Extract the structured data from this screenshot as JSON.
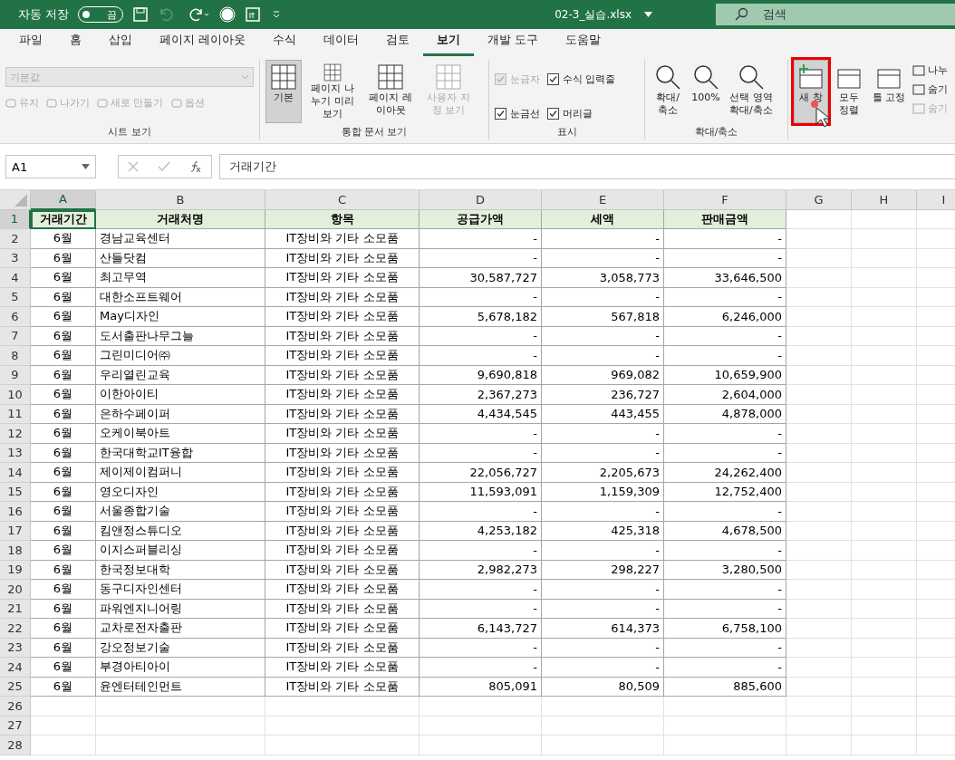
{
  "title_bar": {
    "autosave_label": "자동 저장",
    "autosave_toggle": {
      "on": false,
      "label": "끔"
    },
    "file_name": "02-3_실습.xlsx",
    "search": {
      "placeholder": "검색"
    }
  },
  "tabs": [
    {
      "label": "파일",
      "selected": false
    },
    {
      "label": "홈",
      "selected": false
    },
    {
      "label": "삽입",
      "selected": false
    },
    {
      "label": "페이지 레이아웃",
      "selected": false
    },
    {
      "label": "수식",
      "selected": false
    },
    {
      "label": "데이터",
      "selected": false
    },
    {
      "label": "검토",
      "selected": false
    },
    {
      "label": "보기",
      "selected": true
    },
    {
      "label": "개발 도구",
      "selected": false
    },
    {
      "label": "도움말",
      "selected": false
    }
  ],
  "ribbon": {
    "sheet_view": {
      "label": "시트 보기",
      "dropdown": "기본값",
      "items": [
        {
          "label": "유지",
          "disabled": true
        },
        {
          "label": "나가기",
          "disabled": true
        },
        {
          "label": "새로 만들기",
          "disabled": true
        },
        {
          "label": "옵션",
          "disabled": true
        }
      ]
    },
    "workbook_views": {
      "label": "통합 문서 보기",
      "buttons": [
        {
          "label": "기본",
          "selected": true,
          "disabled": false
        },
        {
          "label": "페이지 나누기 미리 보기",
          "selected": false,
          "disabled": false
        },
        {
          "label": "페이지 레이아웃",
          "selected": false,
          "disabled": false
        },
        {
          "label": "사용자 지정 보기",
          "selected": false,
          "disabled": true
        }
      ]
    },
    "show": {
      "label": "표시",
      "checkboxes": [
        {
          "label": "눈금자",
          "checked": true,
          "disabled": true
        },
        {
          "label": "수식 입력줄",
          "checked": true,
          "disabled": false
        },
        {
          "label": "눈금선",
          "checked": true,
          "disabled": false
        },
        {
          "label": "머리글",
          "checked": true,
          "disabled": false
        }
      ]
    },
    "zoom": {
      "label": "확대/축소",
      "buttons": [
        {
          "label": "확대/\n축소"
        },
        {
          "label": "100%"
        },
        {
          "label": "선택 영역\n확대/축소"
        }
      ]
    },
    "window": {
      "buttons": [
        {
          "label": "새 창",
          "highlighted": true
        },
        {
          "label": "모두\n정렬",
          "highlighted": false
        },
        {
          "label": "틀 고정",
          "highlighted": false
        }
      ],
      "small": [
        {
          "label": "나누",
          "disabled": false
        },
        {
          "label": "숨기",
          "disabled": false
        },
        {
          "label": "숨기",
          "disabled": true
        }
      ]
    }
  },
  "formula_bar": {
    "name_box": "A1",
    "formula": "거래기간"
  },
  "sheet": {
    "columns": [
      {
        "label": "A",
        "selected": true
      },
      {
        "label": "B",
        "selected": false
      },
      {
        "label": "C",
        "selected": false
      },
      {
        "label": "D",
        "selected": false
      },
      {
        "label": "E",
        "selected": false
      },
      {
        "label": "F",
        "selected": false
      },
      {
        "label": "G",
        "selected": false
      },
      {
        "label": "H",
        "selected": false
      },
      {
        "label": "I",
        "selected": false
      }
    ],
    "header": {
      "row": "1",
      "selected": true,
      "cells": [
        "거래기간",
        "거래처명",
        "항목",
        "공급가액",
        "세액",
        "판매금액"
      ]
    },
    "rows": [
      {
        "row": "2",
        "cells": [
          "6월",
          "경남교육센터",
          "IT장비와 기타 소모품",
          "-",
          "-",
          "-"
        ]
      },
      {
        "row": "3",
        "cells": [
          "6월",
          "산들닷컴",
          "IT장비와 기타 소모품",
          "-",
          "-",
          "-"
        ]
      },
      {
        "row": "4",
        "cells": [
          "6월",
          "최고무역",
          "IT장비와 기타 소모품",
          "30,587,727",
          "3,058,773",
          "33,646,500"
        ]
      },
      {
        "row": "5",
        "cells": [
          "6월",
          "대한소프트웨어",
          "IT장비와 기타 소모품",
          "-",
          "-",
          "-"
        ]
      },
      {
        "row": "6",
        "cells": [
          "6월",
          "May디자인",
          "IT장비와 기타 소모품",
          "5,678,182",
          "567,818",
          "6,246,000"
        ]
      },
      {
        "row": "7",
        "cells": [
          "6월",
          "도서출판나무그늘",
          "IT장비와 기타 소모품",
          "-",
          "-",
          "-"
        ]
      },
      {
        "row": "8",
        "cells": [
          "6월",
          "그린미디어㈜",
          "IT장비와 기타 소모품",
          "-",
          "-",
          "-"
        ]
      },
      {
        "row": "9",
        "cells": [
          "6월",
          "우리열린교육",
          "IT장비와 기타 소모품",
          "9,690,818",
          "969,082",
          "10,659,900"
        ]
      },
      {
        "row": "10",
        "cells": [
          "6월",
          "이한아이티",
          "IT장비와 기타 소모품",
          "2,367,273",
          "236,727",
          "2,604,000"
        ]
      },
      {
        "row": "11",
        "cells": [
          "6월",
          "은하수페이퍼",
          "IT장비와 기타 소모품",
          "4,434,545",
          "443,455",
          "4,878,000"
        ]
      },
      {
        "row": "12",
        "cells": [
          "6월",
          "오케이북아트",
          "IT장비와 기타 소모품",
          "-",
          "-",
          "-"
        ]
      },
      {
        "row": "13",
        "cells": [
          "6월",
          "한국대학교IT융합",
          "IT장비와 기타 소모품",
          "-",
          "-",
          "-"
        ]
      },
      {
        "row": "14",
        "cells": [
          "6월",
          "제이제이컴퍼니",
          "IT장비와 기타 소모품",
          "22,056,727",
          "2,205,673",
          "24,262,400"
        ]
      },
      {
        "row": "15",
        "cells": [
          "6월",
          "영오디자인",
          "IT장비와 기타 소모품",
          "11,593,091",
          "1,159,309",
          "12,752,400"
        ]
      },
      {
        "row": "16",
        "cells": [
          "6월",
          "서울종합기술",
          "IT장비와 기타 소모품",
          "-",
          "-",
          "-"
        ]
      },
      {
        "row": "17",
        "cells": [
          "6월",
          "킴앤정스튜디오",
          "IT장비와 기타 소모품",
          "4,253,182",
          "425,318",
          "4,678,500"
        ]
      },
      {
        "row": "18",
        "cells": [
          "6월",
          "이지스퍼블리싱",
          "IT장비와 기타 소모품",
          "-",
          "-",
          "-"
        ]
      },
      {
        "row": "19",
        "cells": [
          "6월",
          "한국정보대학",
          "IT장비와 기타 소모품",
          "2,982,273",
          "298,227",
          "3,280,500"
        ]
      },
      {
        "row": "20",
        "cells": [
          "6월",
          "동구디자인센터",
          "IT장비와 기타 소모품",
          "-",
          "-",
          "-"
        ]
      },
      {
        "row": "21",
        "cells": [
          "6월",
          "파워엔지니어링",
          "IT장비와 기타 소모품",
          "-",
          "-",
          "-"
        ]
      },
      {
        "row": "22",
        "cells": [
          "6월",
          "교차로전자출판",
          "IT장비와 기타 소모품",
          "6,143,727",
          "614,373",
          "6,758,100"
        ]
      },
      {
        "row": "23",
        "cells": [
          "6월",
          "강오정보기술",
          "IT장비와 기타 소모품",
          "-",
          "-",
          "-"
        ]
      },
      {
        "row": "24",
        "cells": [
          "6월",
          "부경아티아이",
          "IT장비와 기타 소모품",
          "-",
          "-",
          "-"
        ]
      },
      {
        "row": "25",
        "cells": [
          "6월",
          "윤엔터테인먼트",
          "IT장비와 기타 소모품",
          "805,091",
          "80,509",
          "885,600"
        ]
      },
      {
        "row": "26"
      },
      {
        "row": "27"
      },
      {
        "row": "28"
      }
    ]
  }
}
